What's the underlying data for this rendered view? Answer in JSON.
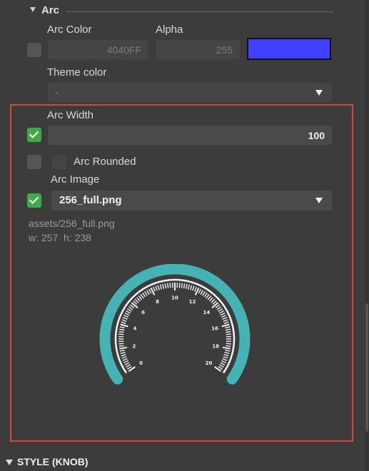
{
  "section": {
    "title": "Arc"
  },
  "arc_color": {
    "label": "Arc Color",
    "value": "4040FF",
    "enabled": false
  },
  "alpha": {
    "label": "Alpha",
    "value": "255"
  },
  "swatch": {
    "color": "#4040ff"
  },
  "theme_color": {
    "label": "Theme color",
    "value": "-"
  },
  "arc_width": {
    "label": "Arc Width",
    "value": "100",
    "enabled": true
  },
  "arc_rounded": {
    "label": "Arc Rounded",
    "checked": false
  },
  "arc_image": {
    "label": "Arc Image",
    "value": "256_full.png",
    "enabled": true
  },
  "image_info": {
    "path": "assets/256_full.png",
    "size": "w: 257  h: 238"
  },
  "gauge": {
    "tick_labels": [
      "0",
      "2",
      "4",
      "6",
      "8",
      "10",
      "12",
      "14",
      "16",
      "18",
      "20"
    ],
    "min": 0,
    "max": 20,
    "arc_color": "#45b3b3"
  },
  "footer": {
    "title": "STYLE (KNOB)"
  }
}
